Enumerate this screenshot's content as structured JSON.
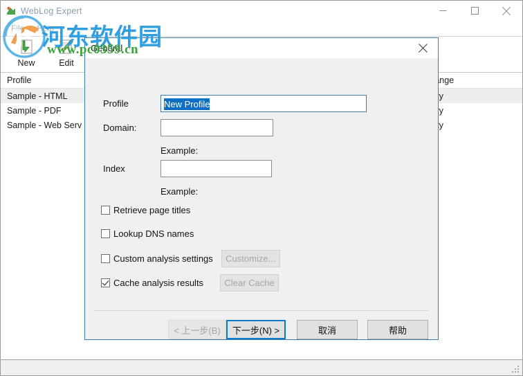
{
  "window": {
    "title": "WebLog Expert",
    "icon": "app-icon",
    "controls": {
      "minimize": "minimize-icon",
      "maximize": "maximize-icon",
      "close": "close-icon"
    }
  },
  "menu": {
    "items": [
      {
        "label": "File"
      },
      {
        "label": "Help"
      }
    ]
  },
  "toolbar": {
    "buttons": [
      {
        "label": "New",
        "icon": "new-profile-icon"
      },
      {
        "label": "Edit",
        "icon": "edit-profile-icon"
      }
    ]
  },
  "profile_list": {
    "columns": [
      "Profile",
      "ange"
    ],
    "rows": [
      {
        "profile": "Sample - HTML",
        "date_range": "ity",
        "selected": true
      },
      {
        "profile": "Sample - PDF",
        "date_range": "ity",
        "selected": false
      },
      {
        "profile": "Sample - Web Serv",
        "date_range": "ity",
        "selected": false
      }
    ]
  },
  "dialog": {
    "title": "General",
    "close_icon": "close-icon",
    "fields": {
      "profile": {
        "label": "Profile",
        "value": "New Profile",
        "selected": true
      },
      "domain": {
        "label": "Domain:",
        "value": "",
        "example": "Example:"
      },
      "index": {
        "label": "Index",
        "value": "",
        "example": "Example:"
      }
    },
    "checkboxes": [
      {
        "label": "Retrieve page titles",
        "checked": false
      },
      {
        "label": "Lookup DNS names",
        "checked": false
      },
      {
        "label": "Custom analysis settings",
        "checked": false,
        "button": "Customize...",
        "button_disabled": true
      },
      {
        "label": "Cache analysis results",
        "checked": true,
        "button": "Clear Cache",
        "button_disabled": true
      }
    ],
    "buttons": {
      "back": "< 上一步(B)",
      "next": "下一步(N) >",
      "cancel": "取消",
      "help": "帮助"
    }
  },
  "watermark": {
    "site_name": "河东软件园",
    "url": "www.pc0359.cn"
  },
  "colors": {
    "accent": "#0f7ac7",
    "dialog_border": "#3a7cb1",
    "selection": "#0b6fc4",
    "dialog_bg": "#f0f0f0",
    "row_selected": "#ededed",
    "watermark_blue": "#2f9fe0",
    "watermark_green": "#3aa33a"
  }
}
